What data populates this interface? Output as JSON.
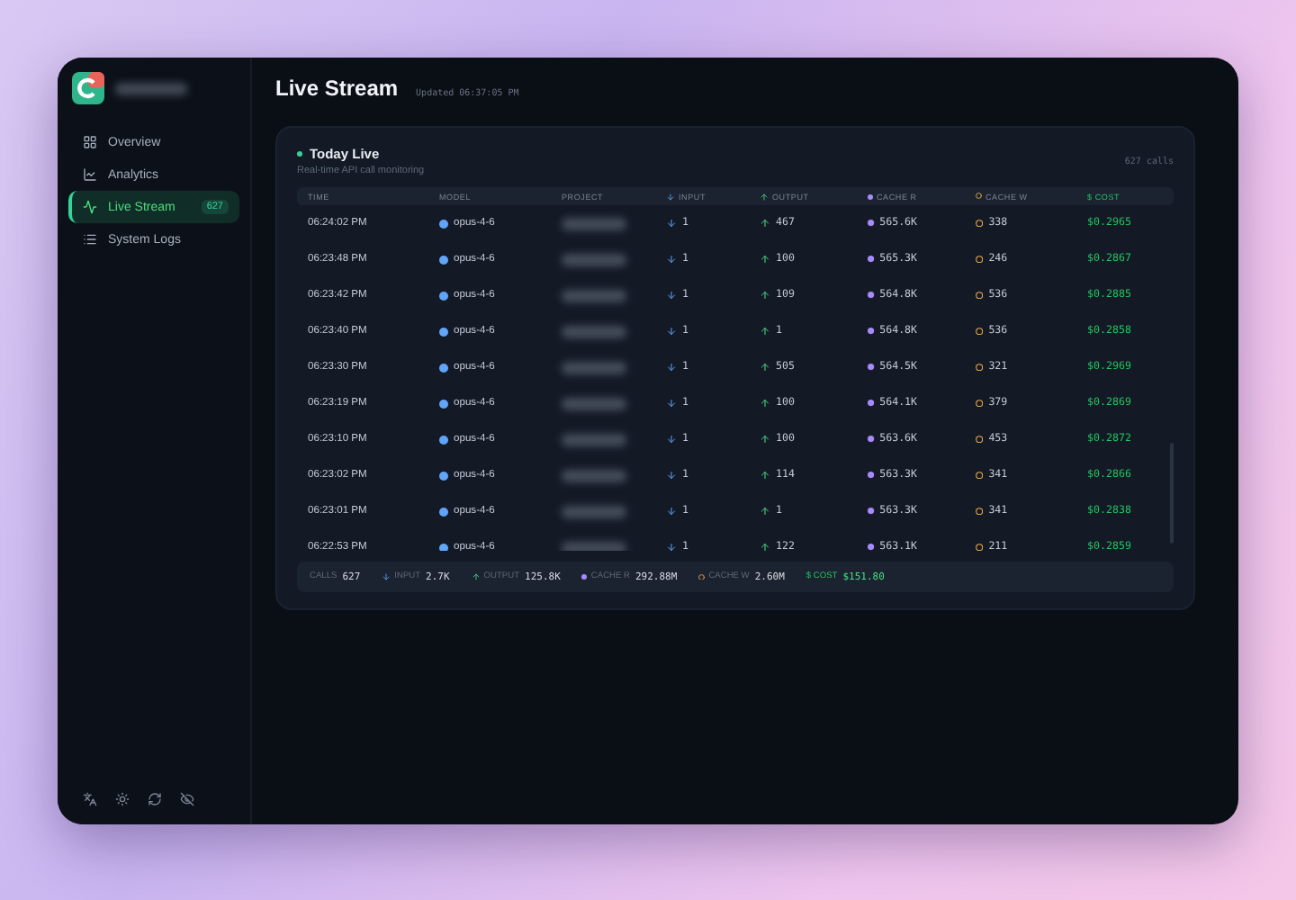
{
  "sidebar": {
    "items": [
      {
        "label": "Overview",
        "selected": false
      },
      {
        "label": "Analytics",
        "selected": false
      },
      {
        "label": "Live Stream",
        "selected": true,
        "badge": "627"
      },
      {
        "label": "System Logs",
        "selected": false
      }
    ]
  },
  "header": {
    "title": "Live Stream",
    "updated": "Updated 06:37:05 PM"
  },
  "card": {
    "title": "Today Live",
    "subtitle": "Real-time API call monitoring",
    "count": "627 calls",
    "columns": [
      {
        "label": "TIME",
        "kind": "plain"
      },
      {
        "label": "MODEL",
        "kind": "plain"
      },
      {
        "label": "PROJECT",
        "kind": "plain"
      },
      {
        "label": "INPUT",
        "kind": "input"
      },
      {
        "label": "OUTPUT",
        "kind": "output"
      },
      {
        "label": "CACHE R",
        "kind": "cache_r"
      },
      {
        "label": "CACHE W",
        "kind": "cache_w"
      },
      {
        "label": "$ COST",
        "kind": "cost"
      }
    ],
    "rows": [
      {
        "time": "06:24:02 PM",
        "model": "opus-4-6",
        "input": "1",
        "output": "467",
        "cache_r": "565.6K",
        "cache_w": "338",
        "cost": "$0.2965"
      },
      {
        "time": "06:23:48 PM",
        "model": "opus-4-6",
        "input": "1",
        "output": "100",
        "cache_r": "565.3K",
        "cache_w": "246",
        "cost": "$0.2867"
      },
      {
        "time": "06:23:42 PM",
        "model": "opus-4-6",
        "input": "1",
        "output": "109",
        "cache_r": "564.8K",
        "cache_w": "536",
        "cost": "$0.2885"
      },
      {
        "time": "06:23:40 PM",
        "model": "opus-4-6",
        "input": "1",
        "output": "1",
        "cache_r": "564.8K",
        "cache_w": "536",
        "cost": "$0.2858"
      },
      {
        "time": "06:23:30 PM",
        "model": "opus-4-6",
        "input": "1",
        "output": "505",
        "cache_r": "564.5K",
        "cache_w": "321",
        "cost": "$0.2969"
      },
      {
        "time": "06:23:19 PM",
        "model": "opus-4-6",
        "input": "1",
        "output": "100",
        "cache_r": "564.1K",
        "cache_w": "379",
        "cost": "$0.2869"
      },
      {
        "time": "06:23:10 PM",
        "model": "opus-4-6",
        "input": "1",
        "output": "100",
        "cache_r": "563.6K",
        "cache_w": "453",
        "cost": "$0.2872"
      },
      {
        "time": "06:23:02 PM",
        "model": "opus-4-6",
        "input": "1",
        "output": "114",
        "cache_r": "563.3K",
        "cache_w": "341",
        "cost": "$0.2866"
      },
      {
        "time": "06:23:01 PM",
        "model": "opus-4-6",
        "input": "1",
        "output": "1",
        "cache_r": "563.3K",
        "cache_w": "341",
        "cost": "$0.2838"
      },
      {
        "time": "06:22:53 PM",
        "model": "opus-4-6",
        "input": "1",
        "output": "122",
        "cache_r": "563.1K",
        "cache_w": "211",
        "cost": "$0.2859"
      }
    ],
    "totals": [
      {
        "kind": "plain",
        "label": "CALLS",
        "value": "627"
      },
      {
        "kind": "input",
        "label": "INPUT",
        "value": "2.7K"
      },
      {
        "kind": "output",
        "label": "OUTPUT",
        "value": "125.8K"
      },
      {
        "kind": "cache_r",
        "label": "CACHE R",
        "value": "292.88M"
      },
      {
        "kind": "cache_w",
        "label": "CACHE W",
        "value": "2.60M"
      },
      {
        "kind": "cost",
        "label": "$ COST",
        "value": "$151.80"
      }
    ]
  }
}
